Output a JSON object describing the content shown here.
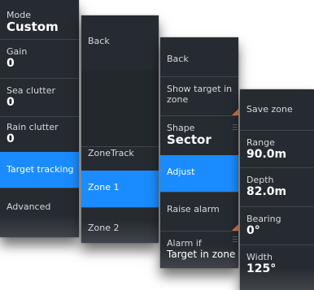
{
  "panel1": {
    "mode_label": "Mode",
    "mode_value": "Custom",
    "gain_label": "Gain",
    "gain_value": "0",
    "sea_label": "Sea clutter",
    "sea_value": "0",
    "rain_label": "Rain clutter",
    "rain_value": "0",
    "target_tracking": "Target tracking",
    "advanced": "Advanced"
  },
  "panel2": {
    "back": "Back",
    "zonetrack": "ZoneTrack",
    "zone1": "Zone 1",
    "zone2": "Zone 2"
  },
  "panel3": {
    "back": "Back",
    "show_target_line1": "Show target in",
    "show_target_line2": "zone",
    "shape_label": "Shape",
    "shape_value": "Sector",
    "adjust": "Adjust",
    "raise_alarm": "Raise alarm",
    "alarm_if_label": "Alarm if",
    "alarm_if_value": "Target in zone"
  },
  "panel4": {
    "save_zone": "Save zone",
    "range_label": "Range",
    "range_value": "90.0m",
    "depth_label": "Depth",
    "depth_value": "82.0m",
    "bearing_label": "Bearing",
    "bearing_value": "0°",
    "width_label": "Width",
    "width_value": "125°"
  },
  "colors": {
    "panel_bg": "#262b31",
    "active": "#1a8cff",
    "accent": "#e8733a"
  }
}
